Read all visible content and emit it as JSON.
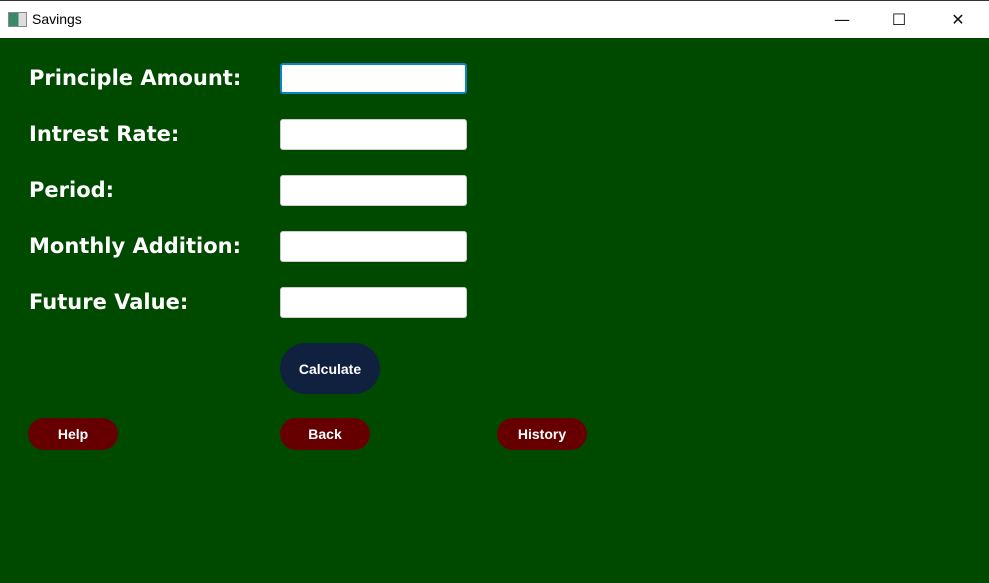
{
  "window": {
    "title": "Savings",
    "minimize": "—",
    "maximize": "☐",
    "close": "✕"
  },
  "form": {
    "fields": [
      {
        "label": "Principle Amount:",
        "value": ""
      },
      {
        "label": "Intrest Rate:",
        "value": ""
      },
      {
        "label": "Period:",
        "value": ""
      },
      {
        "label": "Monthly Addition:",
        "value": ""
      },
      {
        "label": "Future Value:",
        "value": ""
      }
    ],
    "calculate": "Calculate"
  },
  "nav": {
    "help": "Help",
    "back": "Back",
    "history": "History"
  },
  "colors": {
    "background": "#004a00",
    "calculate": "#10203f",
    "nav_buttons": "#660000"
  }
}
